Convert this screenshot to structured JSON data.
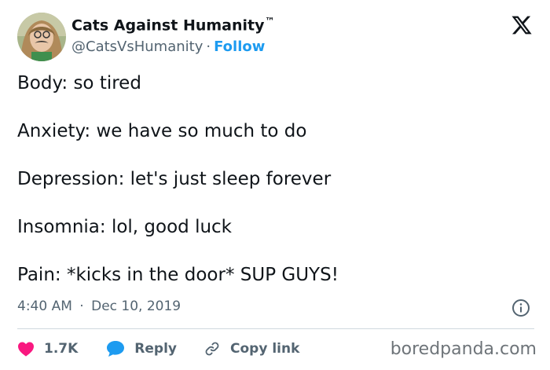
{
  "account": {
    "display_name": "Cats Against Humanity",
    "trademark": "™",
    "handle": "@CatsVsHumanity",
    "separator": "·",
    "follow_label": "Follow"
  },
  "tweet": {
    "lines": [
      "Body: so tired",
      "Anxiety: we have so much to do",
      "Depression: let's just sleep forever",
      "Insomnia: lol, good luck",
      "Pain: *kicks in the door* SUP GUYS!"
    ],
    "time": "4:40 AM",
    "separator": "·",
    "date": "Dec 10, 2019"
  },
  "actions": {
    "like_count": "1.7K",
    "reply_label": "Reply",
    "copy_link_label": "Copy link"
  },
  "watermark": "boredpanda.com",
  "icons": {
    "brand": "x-logo-icon",
    "info": "info-icon",
    "like": "heart-icon",
    "reply": "speech-bubble-icon",
    "copy": "link-icon"
  },
  "colors": {
    "text": "#0f1419",
    "secondary": "#536471",
    "link_blue": "#1d9bf0",
    "heart": "#f91880",
    "divider": "#cfd9de"
  }
}
